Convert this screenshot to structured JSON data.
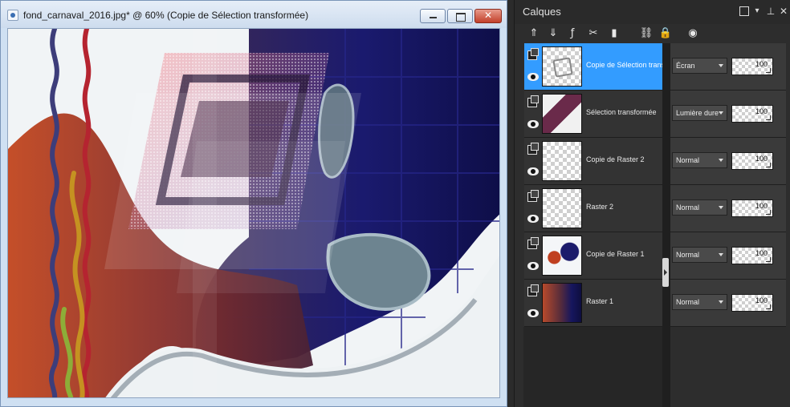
{
  "document_window": {
    "title": "fond_carnaval_2016.jpg* @  60% (Copie de Sélection transformée)",
    "controls": {
      "minimize": "",
      "maximize": "",
      "close": "✕"
    }
  },
  "layers_palette": {
    "title": "Calques",
    "header_controls": {
      "restore": "",
      "dropdown": "▾",
      "pin": "⊥",
      "close": "✕"
    },
    "toolbar": [
      {
        "name": "move-layer-up-icon",
        "glyph": "⇑"
      },
      {
        "name": "move-layer-down-icon",
        "glyph": "⇓"
      },
      {
        "name": "layer-effects-icon",
        "glyph": "ƒ"
      },
      {
        "name": "delete-layer-icon",
        "glyph": "✂"
      },
      {
        "name": "layer-mask-icon",
        "glyph": "▮"
      },
      {
        "name": "link-layers-icon",
        "glyph": "⛓"
      },
      {
        "name": "lock-transparency-icon",
        "glyph": "🔒"
      },
      {
        "name": "layer-properties-icon",
        "glyph": "◉"
      }
    ],
    "layers": [
      {
        "name": "Copie de Sélection transf",
        "blend_mode": "Écran",
        "opacity": "100",
        "selected": true
      },
      {
        "name": "Sélection transformée",
        "blend_mode": "Lumière dure",
        "opacity": "100",
        "selected": false
      },
      {
        "name": "Copie de Raster 2",
        "blend_mode": "Normal",
        "opacity": "100",
        "selected": false
      },
      {
        "name": "Raster 2",
        "blend_mode": "Normal",
        "opacity": "100",
        "selected": false
      },
      {
        "name": "Copie de Raster 1",
        "blend_mode": "Normal",
        "opacity": "100",
        "selected": false
      },
      {
        "name": "Raster 1",
        "blend_mode": "Normal",
        "opacity": "100",
        "selected": false
      }
    ]
  },
  "colors": {
    "selection_blue": "#339cff",
    "canvas_navy": "#16166a",
    "canvas_red": "#b84a2b"
  }
}
